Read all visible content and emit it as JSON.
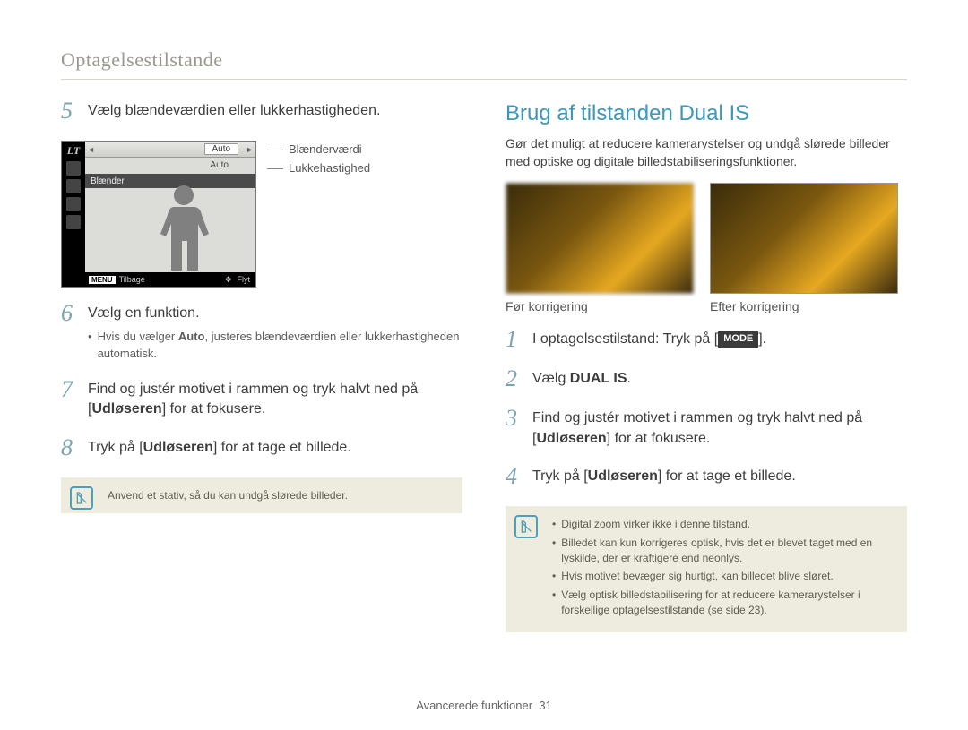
{
  "header": {
    "title": "Optagelsestilstande"
  },
  "left": {
    "step5": "Vælg blændeværdien eller lukkerhastigheden.",
    "camera": {
      "lt": "LT",
      "auto1": "Auto",
      "auto2": "Auto",
      "aperture_label": "Blænder",
      "menu": "MENU",
      "back": "Tilbage",
      "move": "Flyt",
      "right_label_1": "Blænderværdi",
      "right_label_2": "Lukkehastighed"
    },
    "step6": "Vælg en funktion.",
    "step6_note_prefix": "Hvis du vælger ",
    "step6_note_bold": "Auto",
    "step6_note_suffix": ", justeres blændeværdien eller lukkerhastigheden automatisk.",
    "step7a": "Find og justér motivet i rammen og tryk halvt ned på ",
    "step7_key": "Udløseren",
    "step7b": " for at fokusere.",
    "step8a": "Tryk på [",
    "step8_key": "Udløseren",
    "step8b": "] for at tage et billede.",
    "note": "Anvend et stativ, så du kan undgå slørede billeder."
  },
  "right": {
    "heading": "Brug af tilstanden Dual IS",
    "intro": "Gør det muligt at reducere kamerarystelser og undgå slørede billeder med optiske og digitale billedstabiliseringsfunktioner.",
    "caption_before": "Før korrigering",
    "caption_after": "Efter korrigering",
    "step1a": "I optagelsestilstand: Tryk på [",
    "step1_chip": "MODE",
    "step1b": "].",
    "step2a": "Vælg ",
    "step2_key": "DUAL IS",
    "step2b": ".",
    "step3a": "Find og justér motivet i rammen og tryk halvt ned på ",
    "step3_key": "Udløseren",
    "step3b": " for at fokusere.",
    "step4a": "Tryk på [",
    "step4_key": "Udløseren",
    "step4b": "] for at tage et billede.",
    "notes": {
      "n1": "Digital zoom virker ikke i denne tilstand.",
      "n2": "Billedet kan kun korrigeres optisk, hvis det er blevet taget med en lyskilde, der er kraftigere end neonlys.",
      "n3": "Hvis motivet bevæger sig hurtigt, kan billedet blive sløret.",
      "n4": "Vælg optisk billedstabilisering for at reducere kamerarystelser i forskellige optagelsestilstande (se side 23)."
    }
  },
  "footer": {
    "text": "Avancerede funktioner",
    "page": "31"
  }
}
